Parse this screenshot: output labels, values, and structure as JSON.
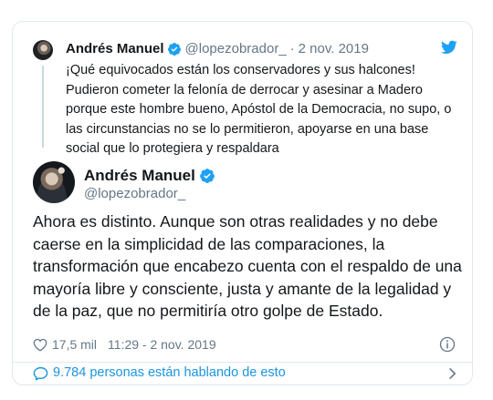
{
  "quoted_tweet": {
    "name": "Andrés Manuel",
    "handle": "@lopezobrador_",
    "separator": "·",
    "date": "2 nov. 2019",
    "text": "¡Qué equivocados están los conservadores y sus halcones! Pudieron cometer la felonía de derrocar y asesinar a Madero porque este hombre bueno, Apóstol de la Democracia, no supo, o las circunstancias no se lo permitieron, apoyarse en una base social que lo protegiera y respaldara"
  },
  "main_tweet": {
    "name": "Andrés Manuel",
    "handle": "@lopezobrador_",
    "text": "Ahora es distinto. Aunque son otras realidades y no debe caerse en la simplicidad de las comparaciones, la transformación que encabezo cuenta con el respaldo de una mayoría libre y consciente, justa y amante de la legalidad y de la paz, que no permitiría otro golpe de Estado.",
    "likes": "17,5 mil",
    "timestamp": "11:29 - 2 nov. 2019"
  },
  "footer": {
    "conversation_text": "9.784 personas están hablando de esto"
  },
  "icons": {
    "verified": "verified-badge-icon",
    "bird": "twitter-bird-icon",
    "heart": "heart-icon",
    "info": "info-icon",
    "bubble": "speech-bubble-icon",
    "chevron": "chevron-right-icon"
  },
  "colors": {
    "brand_blue": "#1da1f2",
    "link_blue": "#1b95e0",
    "text_primary": "#14171a",
    "text_secondary": "#657786",
    "border": "#e1e8ed"
  }
}
